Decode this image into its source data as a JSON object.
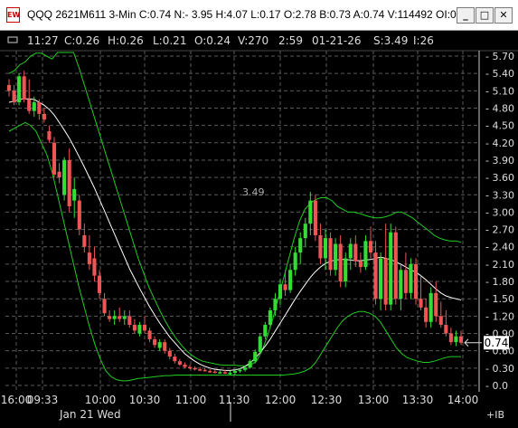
{
  "window": {
    "app_icon": "EW",
    "title": "QQQ 2621M611 3-Min C:0.74 N:- 3.95 H:4.07 L:0.17 O:2.78 B:0.73 A:0.74 V:114492 OI:0",
    "minimize_label": "_",
    "maximize_label": "□",
    "close_label": "✕"
  },
  "info_bar": {
    "time": "11:27",
    "close": "C:0.26",
    "high": "H:0.26",
    "low": "L:0.21",
    "open": "O:0.24",
    "volume": "V:270",
    "clock": "2:59",
    "date": "01-21-26",
    "strike": "S:3.49",
    "i": "I:26"
  },
  "annotation": "3.49",
  "price_marker": "0.74",
  "chart_data": {
    "type": "candlestick",
    "y_ticks": [
      "5.70",
      "5.40",
      "5.10",
      "4.80",
      "4.50",
      "4.20",
      "3.90",
      "3.60",
      "3.30",
      "3.00",
      "2.70",
      "2.40",
      "2.10",
      "1.80",
      "1.50",
      "1.20",
      "0.90",
      "0.60",
      "0.30",
      "0.0"
    ],
    "x_ticks": [
      "16:00",
      "09:33",
      "10:00",
      "10:30",
      "11:00",
      "11:30",
      "12:00",
      "12:30",
      "13:00",
      "13:30",
      "14:00"
    ],
    "x_ticks_bottom": "Jan 21 Wed",
    "right_tag": "+IB",
    "candles": [
      [
        5.2,
        5.3,
        5.0,
        5.1
      ],
      [
        5.1,
        5.2,
        4.85,
        4.9
      ],
      [
        4.9,
        5.4,
        4.85,
        5.35
      ],
      [
        5.35,
        5.45,
        4.9,
        4.95
      ],
      [
        4.95,
        5.3,
        4.7,
        4.75
      ],
      [
        4.75,
        5.0,
        4.65,
        4.9
      ],
      [
        4.9,
        4.95,
        4.6,
        4.7
      ],
      [
        4.7,
        4.8,
        4.55,
        4.6
      ],
      [
        4.4,
        4.5,
        4.2,
        4.25
      ],
      [
        4.2,
        4.3,
        3.6,
        3.65
      ],
      [
        3.7,
        3.85,
        3.5,
        3.6
      ],
      [
        3.3,
        3.95,
        3.2,
        3.9
      ],
      [
        3.9,
        4.1,
        3.0,
        3.1
      ],
      [
        3.2,
        3.6,
        2.9,
        3.4
      ],
      [
        3.2,
        3.3,
        2.6,
        2.7
      ],
      [
        2.6,
        2.8,
        2.3,
        2.4
      ],
      [
        2.3,
        2.6,
        2.0,
        2.1
      ],
      [
        2.2,
        2.4,
        1.8,
        1.9
      ],
      [
        1.9,
        2.0,
        1.5,
        1.6
      ],
      [
        1.5,
        1.6,
        1.2,
        1.25
      ],
      [
        1.2,
        1.3,
        1.1,
        1.15
      ],
      [
        1.15,
        1.3,
        1.05,
        1.2
      ],
      [
        1.2,
        1.35,
        1.1,
        1.15
      ],
      [
        1.15,
        1.3,
        1.05,
        1.2
      ],
      [
        1.2,
        1.3,
        1.0,
        1.05
      ],
      [
        1.05,
        1.15,
        0.9,
        0.95
      ],
      [
        0.9,
        1.1,
        0.85,
        1.05
      ],
      [
        1.05,
        1.2,
        0.9,
        0.95
      ],
      [
        0.95,
        1.0,
        0.75,
        0.8
      ],
      [
        0.8,
        0.85,
        0.65,
        0.7
      ],
      [
        0.65,
        0.8,
        0.6,
        0.75
      ],
      [
        0.75,
        0.8,
        0.55,
        0.6
      ],
      [
        0.6,
        0.65,
        0.45,
        0.5
      ],
      [
        0.5,
        0.55,
        0.38,
        0.42
      ],
      [
        0.42,
        0.46,
        0.34,
        0.36
      ],
      [
        0.36,
        0.4,
        0.3,
        0.32
      ],
      [
        0.32,
        0.36,
        0.28,
        0.3
      ],
      [
        0.3,
        0.33,
        0.26,
        0.28
      ],
      [
        0.28,
        0.32,
        0.25,
        0.27
      ],
      [
        0.27,
        0.3,
        0.24,
        0.25
      ],
      [
        0.25,
        0.28,
        0.22,
        0.24
      ],
      [
        0.24,
        0.27,
        0.21,
        0.22
      ],
      [
        0.22,
        0.26,
        0.2,
        0.23
      ],
      [
        0.23,
        0.27,
        0.2,
        0.21
      ],
      [
        0.21,
        0.25,
        0.18,
        0.22
      ],
      [
        0.22,
        0.28,
        0.19,
        0.25
      ],
      [
        0.25,
        0.3,
        0.22,
        0.27
      ],
      [
        0.27,
        0.34,
        0.24,
        0.31
      ],
      [
        0.31,
        0.45,
        0.29,
        0.42
      ],
      [
        0.42,
        0.62,
        0.38,
        0.58
      ],
      [
        0.58,
        0.9,
        0.55,
        0.85
      ],
      [
        0.85,
        1.1,
        0.8,
        1.05
      ],
      [
        1.05,
        1.35,
        1.0,
        1.3
      ],
      [
        1.3,
        1.6,
        1.2,
        1.5
      ],
      [
        1.5,
        1.85,
        1.4,
        1.75
      ],
      [
        1.75,
        2.0,
        1.55,
        1.65
      ],
      [
        1.65,
        2.1,
        1.6,
        2.0
      ],
      [
        2.0,
        2.4,
        1.9,
        2.3
      ],
      [
        2.3,
        2.65,
        2.1,
        2.55
      ],
      [
        2.55,
        2.9,
        2.4,
        2.8
      ],
      [
        2.8,
        3.35,
        2.6,
        3.2
      ],
      [
        3.2,
        3.3,
        2.5,
        2.6
      ],
      [
        2.6,
        2.8,
        2.1,
        2.2
      ],
      [
        2.2,
        2.7,
        2.0,
        2.55
      ],
      [
        2.55,
        2.65,
        1.9,
        2.0
      ],
      [
        2.0,
        2.55,
        1.9,
        2.45
      ],
      [
        2.45,
        2.6,
        1.7,
        1.8
      ],
      [
        1.8,
        2.3,
        1.7,
        2.2
      ],
      [
        2.2,
        2.55,
        2.0,
        2.45
      ],
      [
        2.45,
        2.6,
        2.05,
        2.15
      ],
      [
        2.15,
        2.3,
        1.95,
        2.05
      ],
      [
        2.05,
        2.6,
        2.0,
        2.5
      ],
      [
        2.5,
        2.75,
        2.2,
        2.3
      ],
      [
        2.3,
        2.5,
        1.4,
        1.5
      ],
      [
        1.5,
        2.3,
        1.3,
        2.2
      ],
      [
        2.2,
        2.8,
        1.3,
        1.4
      ],
      [
        1.4,
        2.8,
        1.3,
        2.65
      ],
      [
        2.65,
        2.75,
        1.4,
        1.5
      ],
      [
        1.5,
        2.1,
        1.3,
        2.0
      ],
      [
        2.0,
        2.3,
        1.5,
        1.6
      ],
      [
        1.6,
        2.2,
        1.5,
        2.1
      ],
      [
        2.1,
        2.2,
        1.4,
        1.5
      ],
      [
        1.5,
        1.9,
        1.3,
        1.35
      ],
      [
        1.35,
        1.5,
        1.0,
        1.1
      ],
      [
        1.1,
        1.7,
        1.0,
        1.6
      ],
      [
        1.6,
        1.8,
        1.1,
        1.2
      ],
      [
        1.2,
        1.45,
        1.0,
        1.05
      ],
      [
        1.05,
        1.3,
        0.85,
        0.9
      ],
      [
        0.9,
        1.0,
        0.7,
        0.75
      ],
      [
        0.75,
        0.95,
        0.68,
        0.85
      ],
      [
        0.85,
        0.95,
        0.7,
        0.74
      ]
    ],
    "ma": [
      4.9,
      4.92,
      4.95,
      4.96,
      4.96,
      4.95,
      4.9,
      4.85,
      4.78,
      4.68,
      4.55,
      4.42,
      4.28,
      4.12,
      3.95,
      3.78,
      3.6,
      3.42,
      3.22,
      3.02,
      2.82,
      2.62,
      2.42,
      2.22,
      2.02,
      1.85,
      1.68,
      1.52,
      1.36,
      1.22,
      1.08,
      0.96,
      0.84,
      0.74,
      0.64,
      0.55,
      0.48,
      0.42,
      0.37,
      0.33,
      0.3,
      0.28,
      0.27,
      0.26,
      0.26,
      0.27,
      0.29,
      0.33,
      0.39,
      0.47,
      0.57,
      0.68,
      0.8,
      0.94,
      1.08,
      1.22,
      1.36,
      1.5,
      1.63,
      1.75,
      1.87,
      1.97,
      2.05,
      2.11,
      2.15,
      2.17,
      2.18,
      2.18,
      2.17,
      2.16,
      2.16,
      2.17,
      2.18,
      2.2,
      2.22,
      2.2,
      2.18,
      2.14,
      2.1,
      2.05,
      2.0,
      1.96,
      1.9,
      1.83,
      1.75,
      1.67,
      1.6,
      1.55,
      1.52,
      1.5,
      1.48
    ],
    "bb_upper": [
      5.4,
      5.45,
      5.55,
      5.6,
      5.7,
      5.75,
      5.75,
      5.7,
      5.65,
      6.0,
      6.2,
      6.0,
      5.8,
      5.5,
      5.2,
      4.9,
      4.6,
      4.3,
      4.0,
      3.7,
      3.4,
      3.1,
      2.8,
      2.5,
      2.2,
      1.95,
      1.7,
      1.5,
      1.3,
      1.12,
      0.96,
      0.82,
      0.7,
      0.6,
      0.52,
      0.46,
      0.42,
      0.4,
      0.38,
      0.36,
      0.35,
      0.35,
      0.35,
      0.34,
      0.34,
      0.36,
      0.42,
      0.6,
      0.85,
      1.15,
      1.5,
      1.85,
      2.2,
      2.55,
      2.85,
      3.05,
      3.15,
      3.22,
      3.25,
      3.25,
      3.2,
      3.1,
      3.05,
      3.0,
      3.0,
      2.98,
      2.95,
      2.92,
      2.9,
      2.9,
      2.92,
      2.95,
      3.0,
      3.0,
      2.95,
      2.9,
      2.82,
      2.75,
      2.68,
      2.6,
      2.55,
      2.52,
      2.5,
      2.5,
      2.48
    ],
    "bb_lower": [
      4.4,
      4.45,
      4.5,
      4.55,
      4.5,
      4.4,
      4.2,
      4.0,
      3.7,
      3.3,
      2.9,
      2.5,
      2.1,
      1.7,
      1.35,
      1.0,
      0.7,
      0.45,
      0.25,
      0.15,
      0.1,
      0.08,
      0.08,
      0.1,
      0.12,
      0.13,
      0.14,
      0.15,
      0.16,
      0.17,
      0.17,
      0.18,
      0.18,
      0.18,
      0.18,
      0.18,
      0.18,
      0.18,
      0.18,
      0.18,
      0.18,
      0.18,
      0.18,
      0.18,
      0.18,
      0.18,
      0.18,
      0.18,
      0.18,
      0.18,
      0.18,
      0.18,
      0.19,
      0.2,
      0.22,
      0.25,
      0.3,
      0.4,
      0.55,
      0.7,
      0.85,
      1.0,
      1.12,
      1.2,
      1.25,
      1.28,
      1.28,
      1.25,
      1.2,
      1.1,
      0.95,
      0.8,
      0.65,
      0.55,
      0.48,
      0.45,
      0.42,
      0.4,
      0.4,
      0.42,
      0.45,
      0.48,
      0.5,
      0.5,
      0.5
    ]
  },
  "colors": {
    "up": "#33dd33",
    "down": "#ee5555",
    "bands": "#22cc22",
    "ma": "#ffffff",
    "grid": "#5a5a5a"
  }
}
